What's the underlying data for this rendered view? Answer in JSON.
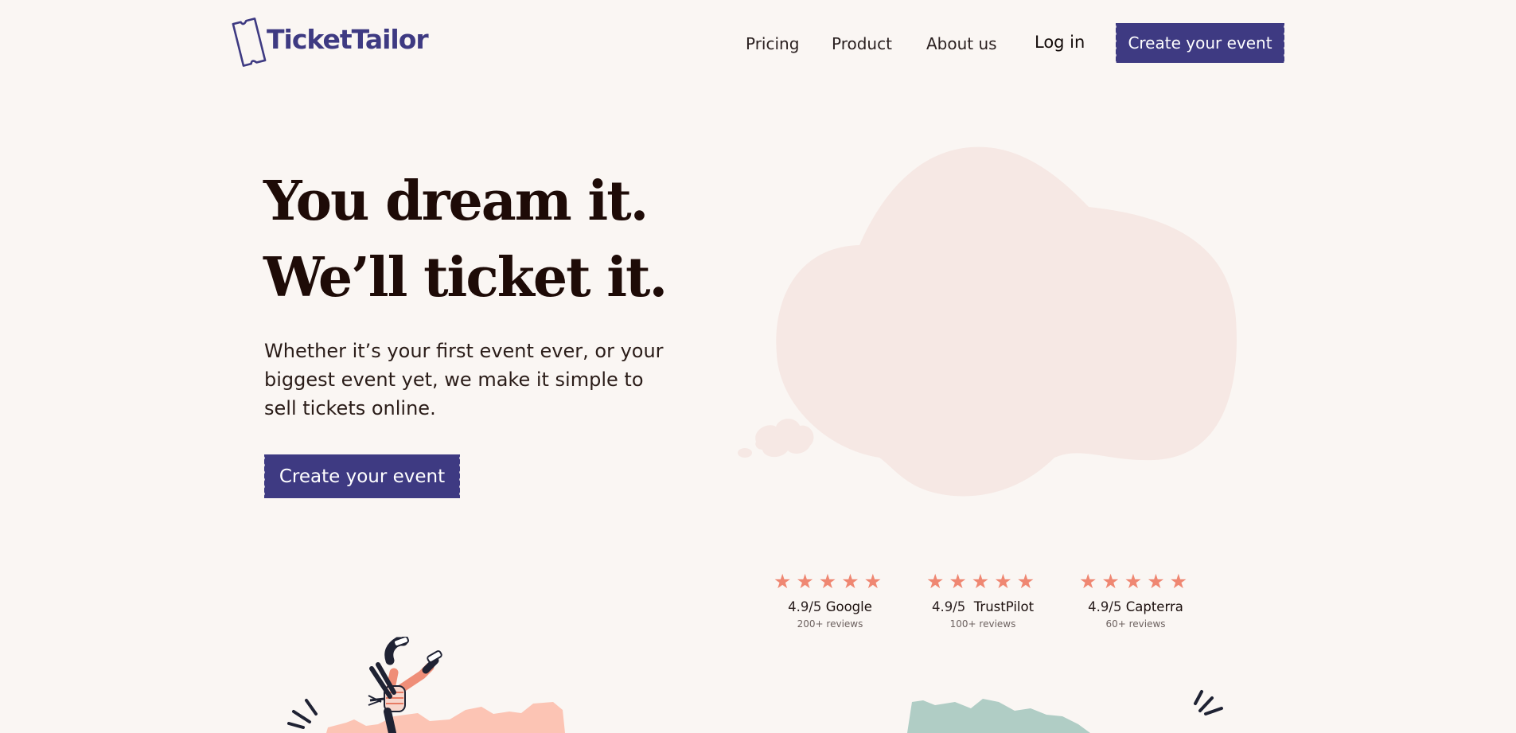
{
  "header": {
    "logo_text": "TicketTailor",
    "nav": [
      "Pricing",
      "Product",
      "About us"
    ],
    "login": "Log in",
    "cta": "Create your event"
  },
  "hero": {
    "headline_line1": "You dream it.",
    "headline_line2": "We’ll ticket it.",
    "lede": "Whether it’s your first event ever, or your biggest event yet, we make it simple to sell tickets online.",
    "cta": "Create your event"
  },
  "ratings": [
    {
      "score": "4.9/5",
      "source": "Google",
      "reviews": "200+ reviews",
      "stars": 5
    },
    {
      "score": "4.9/5",
      "source": "TrustPilot",
      "reviews": "100+ reviews",
      "stars": 5
    },
    {
      "score": "4.9/5",
      "source": "Capterra",
      "reviews": "60+ reviews",
      "stars": 5
    }
  ],
  "colors": {
    "brand": "#3e3a82",
    "background": "#faf6f3",
    "cloud": "#f6e8e4",
    "star": "#ef8772",
    "hill_pink": "#fcc4b4",
    "hill_green": "#b0cdc5"
  },
  "icons": [
    "ticket-logo-icon",
    "star-icon",
    "thought-cloud-illustration",
    "breakdancer-illustration"
  ]
}
